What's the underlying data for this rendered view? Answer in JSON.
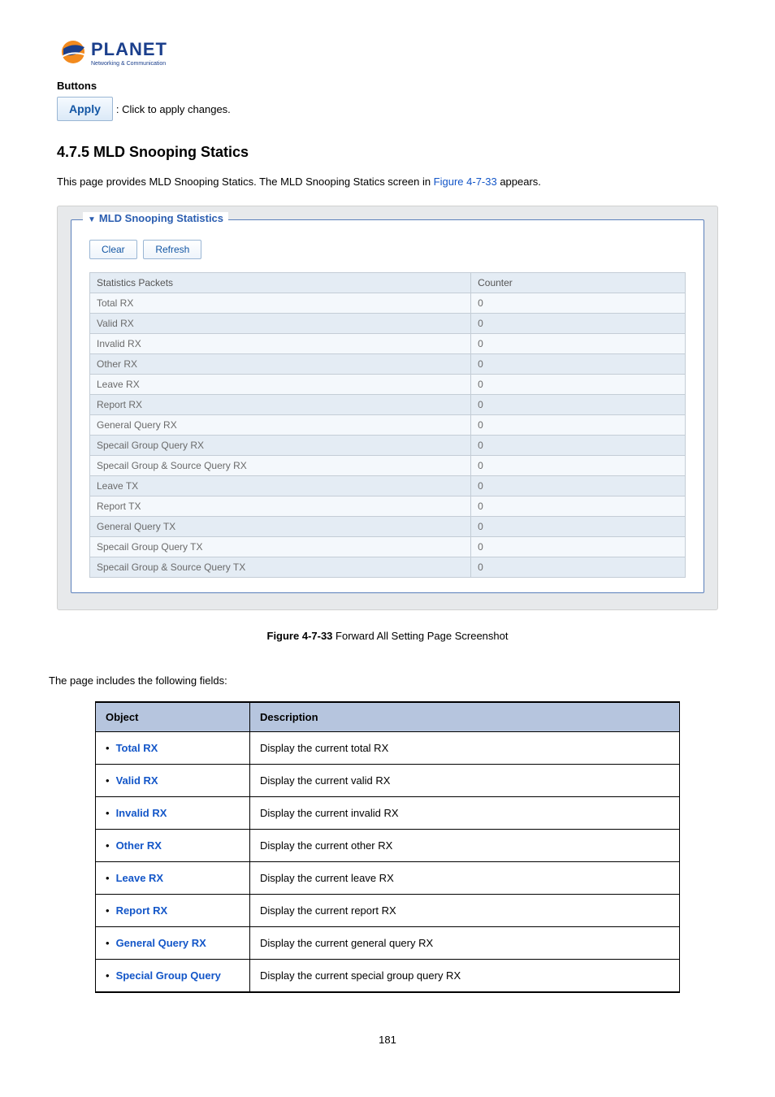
{
  "logo": {
    "brand": "PLANET",
    "tagline": "Networking & Communication"
  },
  "buttons_section": {
    "label": "Buttons",
    "apply_label": "Apply",
    "apply_desc": ": Click to apply changes."
  },
  "heading": "4.7.5 MLD Snooping Statics",
  "intro": {
    "text_pre": "This page provides MLD Snooping Statics. The MLD Snooping Statics screen in ",
    "figref": "Figure 4-7-33",
    "text_post": " appears."
  },
  "panel": {
    "title": "MLD Snooping Statistics",
    "clear_label": "Clear",
    "refresh_label": "Refresh",
    "header_left": "Statistics Packets",
    "header_right": "Counter",
    "rows": [
      {
        "name": "Total RX",
        "value": "0"
      },
      {
        "name": "Valid RX",
        "value": "0"
      },
      {
        "name": "Invalid RX",
        "value": "0"
      },
      {
        "name": "Other RX",
        "value": "0"
      },
      {
        "name": "Leave RX",
        "value": "0"
      },
      {
        "name": "Report RX",
        "value": "0"
      },
      {
        "name": "General Query RX",
        "value": "0"
      },
      {
        "name": "Specail Group Query RX",
        "value": "0"
      },
      {
        "name": "Specail Group & Source Query RX",
        "value": "0"
      },
      {
        "name": "Leave TX",
        "value": "0"
      },
      {
        "name": "Report TX",
        "value": "0"
      },
      {
        "name": "General Query TX",
        "value": "0"
      },
      {
        "name": "Specail Group Query TX",
        "value": "0"
      },
      {
        "name": "Specail Group & Source Query TX",
        "value": "0"
      }
    ]
  },
  "figure_caption": {
    "fignum": "Figure 4-7-33",
    "text": " Forward All Setting Page Screenshot"
  },
  "fields_intro": "The page includes the following fields:",
  "fields_table": {
    "header_object": "Object",
    "header_description": "Description",
    "rows": [
      {
        "object": "Total RX",
        "description": "Display the current total RX"
      },
      {
        "object": "Valid RX",
        "description": "Display the current valid RX"
      },
      {
        "object": "Invalid RX",
        "description": "Display the current invalid RX"
      },
      {
        "object": "Other RX",
        "description": "Display the current other RX"
      },
      {
        "object": "Leave RX",
        "description": "Display the current leave RX"
      },
      {
        "object": "Report RX",
        "description": "Display the current report RX"
      },
      {
        "object": "General Query RX",
        "description": "Display the current general query RX"
      },
      {
        "object": "Special Group Query",
        "description": "Display the current special group query RX"
      }
    ]
  },
  "page_number": "181"
}
